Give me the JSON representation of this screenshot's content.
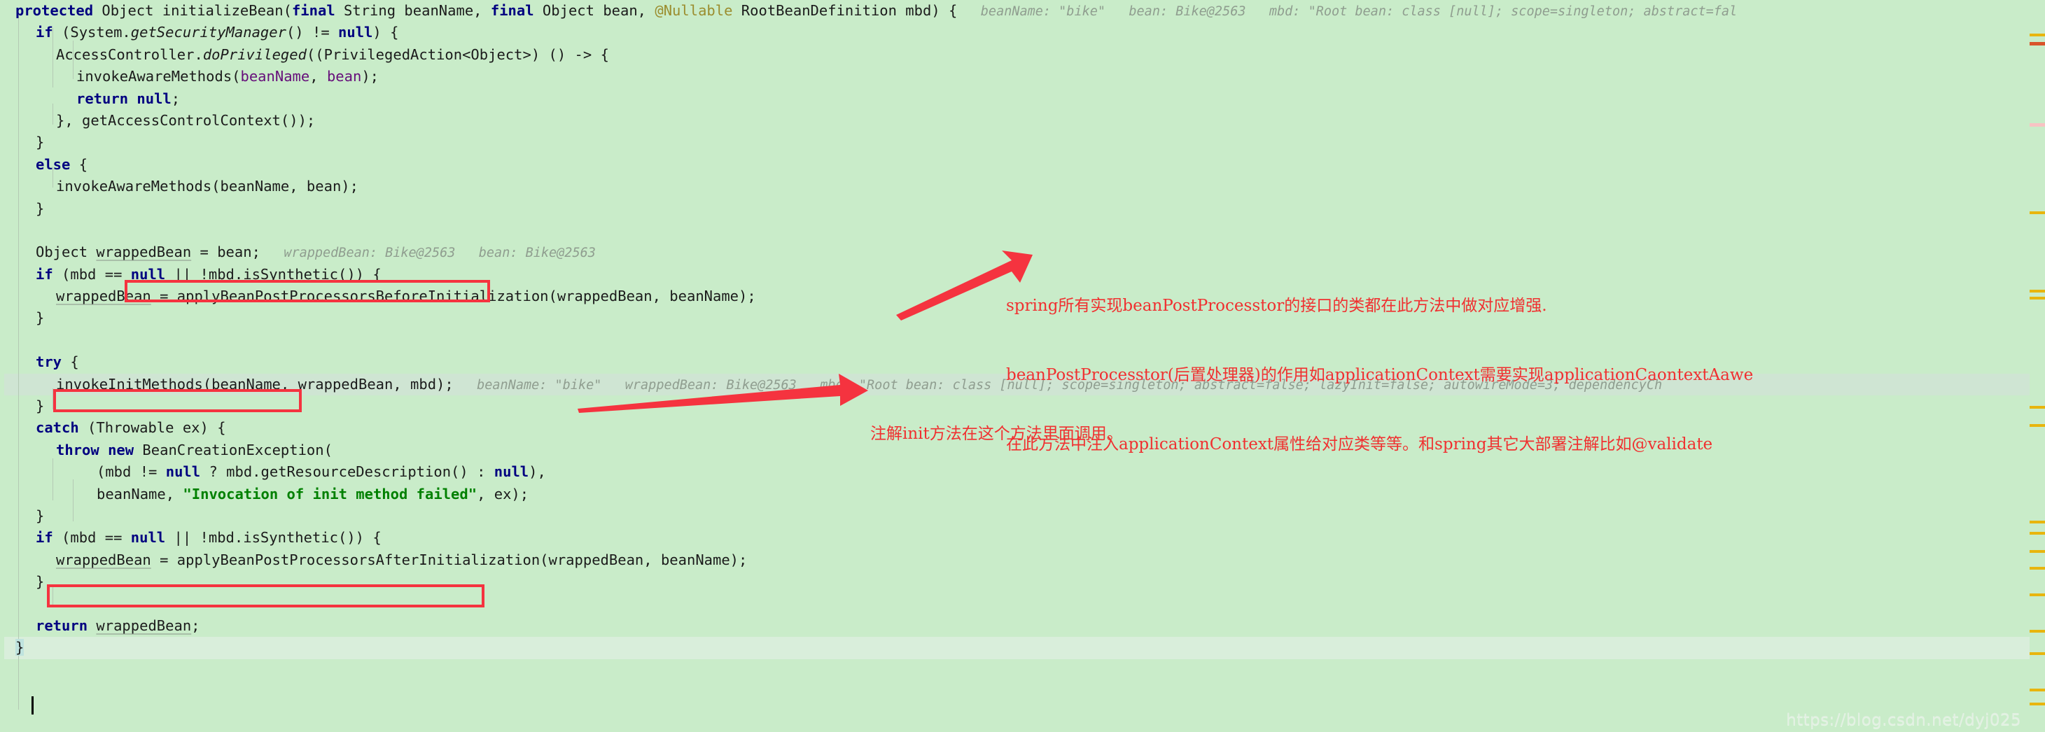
{
  "window": {
    "type": "code-editor",
    "language": "java",
    "background_color": "#c9ecc9",
    "watermark": "https://blog.csdn.net/dyj025"
  },
  "code_lines": [
    {
      "indent": 0,
      "tokens": [
        {
          "t": "protected",
          "c": "kw"
        },
        {
          "t": " Object initializeBean(",
          "c": "plain"
        },
        {
          "t": "final",
          "c": "kw"
        },
        {
          "t": " String beanName, ",
          "c": "plain"
        },
        {
          "t": "final",
          "c": "kw"
        },
        {
          "t": " Object bean, ",
          "c": "plain"
        },
        {
          "t": "@Nullable",
          "c": "anno"
        },
        {
          "t": " RootBeanDefinition mbd) {",
          "c": "plain"
        }
      ],
      "hint": "beanName: \"bike\"   bean: Bike@2563   mbd: \"Root bean: class [null]; scope=singleton; abstract=fal"
    },
    {
      "indent": 1,
      "tokens": [
        {
          "t": "if",
          "c": "kw"
        },
        {
          "t": " (System.",
          "c": "plain"
        },
        {
          "t": "getSecurityManager",
          "c": "method-it"
        },
        {
          "t": "() != ",
          "c": "plain"
        },
        {
          "t": "null",
          "c": "kw"
        },
        {
          "t": ") {",
          "c": "plain"
        }
      ],
      "hint": ""
    },
    {
      "indent": 2,
      "tokens": [
        {
          "t": "AccessController.",
          "c": "plain"
        },
        {
          "t": "doPrivileged",
          "c": "method-it"
        },
        {
          "t": "((PrivilegedAction<Object>) () -> {",
          "c": "plain"
        }
      ],
      "hint": ""
    },
    {
      "indent": 3,
      "tokens": [
        {
          "t": "invokeAwareMethods(",
          "c": "plain"
        },
        {
          "t": "beanName",
          "c": "field"
        },
        {
          "t": ", ",
          "c": "plain"
        },
        {
          "t": "bean",
          "c": "field"
        },
        {
          "t": ");",
          "c": "plain"
        }
      ],
      "hint": ""
    },
    {
      "indent": 3,
      "tokens": [
        {
          "t": "return",
          "c": "kw"
        },
        {
          "t": " ",
          "c": "plain"
        },
        {
          "t": "null",
          "c": "kw"
        },
        {
          "t": ";",
          "c": "plain"
        }
      ],
      "hint": ""
    },
    {
      "indent": 2,
      "tokens": [
        {
          "t": "}, getAccessControlContext());",
          "c": "plain"
        }
      ],
      "hint": ""
    },
    {
      "indent": 1,
      "tokens": [
        {
          "t": "}",
          "c": "plain"
        }
      ],
      "hint": ""
    },
    {
      "indent": 1,
      "tokens": [
        {
          "t": "else",
          "c": "kw"
        },
        {
          "t": " {",
          "c": "plain"
        }
      ],
      "hint": ""
    },
    {
      "indent": 2,
      "tokens": [
        {
          "t": "invokeAwareMethods(beanName, bean);",
          "c": "plain"
        }
      ],
      "hint": ""
    },
    {
      "indent": 1,
      "tokens": [
        {
          "t": "}",
          "c": "plain"
        }
      ],
      "hint": ""
    },
    {
      "indent": 0,
      "tokens": [],
      "hint": ""
    },
    {
      "indent": 1,
      "tokens": [
        {
          "t": "Object ",
          "c": "plain"
        },
        {
          "t": "wrappedBean",
          "c": "decl"
        },
        {
          "t": " = bean;",
          "c": "plain"
        }
      ],
      "hint": "wrappedBean: Bike@2563   bean: Bike@2563"
    },
    {
      "indent": 1,
      "tokens": [
        {
          "t": "if",
          "c": "kw"
        },
        {
          "t": " (mbd == ",
          "c": "plain"
        },
        {
          "t": "null",
          "c": "kw"
        },
        {
          "t": " || !mbd.isSynthetic()) {",
          "c": "plain"
        }
      ],
      "hint": ""
    },
    {
      "indent": 2,
      "tokens": [
        {
          "t": "wrappedBean",
          "c": "decl"
        },
        {
          "t": " = applyBeanPostProcessorsBeforeInitialization(wrappedBean, beanName);",
          "c": "plain"
        }
      ],
      "hint": ""
    },
    {
      "indent": 1,
      "tokens": [
        {
          "t": "}",
          "c": "plain"
        }
      ],
      "hint": ""
    },
    {
      "indent": 0,
      "tokens": [],
      "hint": ""
    },
    {
      "indent": 1,
      "tokens": [
        {
          "t": "try",
          "c": "kw"
        },
        {
          "t": " {",
          "c": "plain"
        }
      ],
      "hint": ""
    },
    {
      "indent": 2,
      "exec": true,
      "tokens": [
        {
          "t": "invokeInitMethods(beanName, wrappedBean, mbd);",
          "c": "plain"
        }
      ],
      "hint": "beanName: \"bike\"   wrappedBean: Bike@2563   mbd: \"Root bean: class [null]; scope=singleton; abstract=false; lazyInit=false; autowireMode=3; dependencyCh"
    },
    {
      "indent": 1,
      "tokens": [
        {
          "t": "}",
          "c": "plain"
        }
      ],
      "hint": ""
    },
    {
      "indent": 1,
      "tokens": [
        {
          "t": "catch",
          "c": "kw"
        },
        {
          "t": " (Throwable ex) {",
          "c": "plain"
        }
      ],
      "hint": ""
    },
    {
      "indent": 2,
      "tokens": [
        {
          "t": "throw",
          "c": "kw"
        },
        {
          "t": " ",
          "c": "plain"
        },
        {
          "t": "new",
          "c": "kw"
        },
        {
          "t": " BeanCreationException(",
          "c": "plain"
        }
      ],
      "hint": ""
    },
    {
      "indent": 4,
      "tokens": [
        {
          "t": "(mbd != ",
          "c": "plain"
        },
        {
          "t": "null",
          "c": "kw"
        },
        {
          "t": " ? mbd.getResourceDescription() : ",
          "c": "plain"
        },
        {
          "t": "null",
          "c": "kw"
        },
        {
          "t": "),",
          "c": "plain"
        }
      ],
      "hint": ""
    },
    {
      "indent": 4,
      "tokens": [
        {
          "t": "beanName, ",
          "c": "plain"
        },
        {
          "t": "\"Invocation of init method failed\"",
          "c": "str"
        },
        {
          "t": ", ex);",
          "c": "plain"
        }
      ],
      "hint": ""
    },
    {
      "indent": 1,
      "tokens": [
        {
          "t": "}",
          "c": "plain"
        }
      ],
      "hint": ""
    },
    {
      "indent": 1,
      "tokens": [
        {
          "t": "if",
          "c": "kw"
        },
        {
          "t": " (mbd == ",
          "c": "plain"
        },
        {
          "t": "null",
          "c": "kw"
        },
        {
          "t": " || !mbd.isSynthetic()) {",
          "c": "plain"
        }
      ],
      "hint": ""
    },
    {
      "indent": 2,
      "tokens": [
        {
          "t": "wrappedBean",
          "c": "decl"
        },
        {
          "t": " = applyBeanPostProcessorsAfterInitialization(wrappedBean, beanName);",
          "c": "plain"
        }
      ],
      "hint": ""
    },
    {
      "indent": 1,
      "tokens": [
        {
          "t": "}",
          "c": "plain"
        }
      ],
      "hint": ""
    },
    {
      "indent": 0,
      "tokens": [],
      "hint": ""
    },
    {
      "indent": 1,
      "tokens": [
        {
          "t": "return",
          "c": "kw"
        },
        {
          "t": " ",
          "c": "plain"
        },
        {
          "t": "wrappedBean",
          "c": "decl"
        },
        {
          "t": ";",
          "c": "plain"
        }
      ],
      "hint": ""
    },
    {
      "indent": 0,
      "caret": true,
      "tokens": [
        {
          "t": "}",
          "c": "plain",
          "sel": true
        }
      ],
      "hint": ""
    }
  ],
  "annotations": {
    "note_post_processor": {
      "color": "#f03030",
      "lines": [
        "spring所有实现beanPostProcesstor的接口的类都在此方法中做对应增强.",
        "beanPostProcesstor(后置处理器)的作用如applicationContext需要实现applicationCaontextAawe",
        "在此方法中注入applicationContext属性给对应类等等。和spring其它大部署注解比如@validate"
      ]
    },
    "note_init_method": {
      "color": "#f03030",
      "lines": [
        "注解init方法在这个方法里面调用。"
      ]
    }
  },
  "highlight_boxes": [
    {
      "name": "before-initialization-box",
      "color": "#f5333f"
    },
    {
      "name": "invoke-init-methods-box",
      "color": "#f5333f"
    },
    {
      "name": "after-initialization-box",
      "color": "#f5333f"
    }
  ],
  "scrollbar_markers": {
    "color": "#e8b50d",
    "error_color": "#d9542b",
    "positions": [
      24,
      30,
      88,
      151,
      207,
      212,
      290,
      303,
      372,
      380,
      393,
      405,
      424,
      450,
      466,
      492,
      502
    ]
  }
}
